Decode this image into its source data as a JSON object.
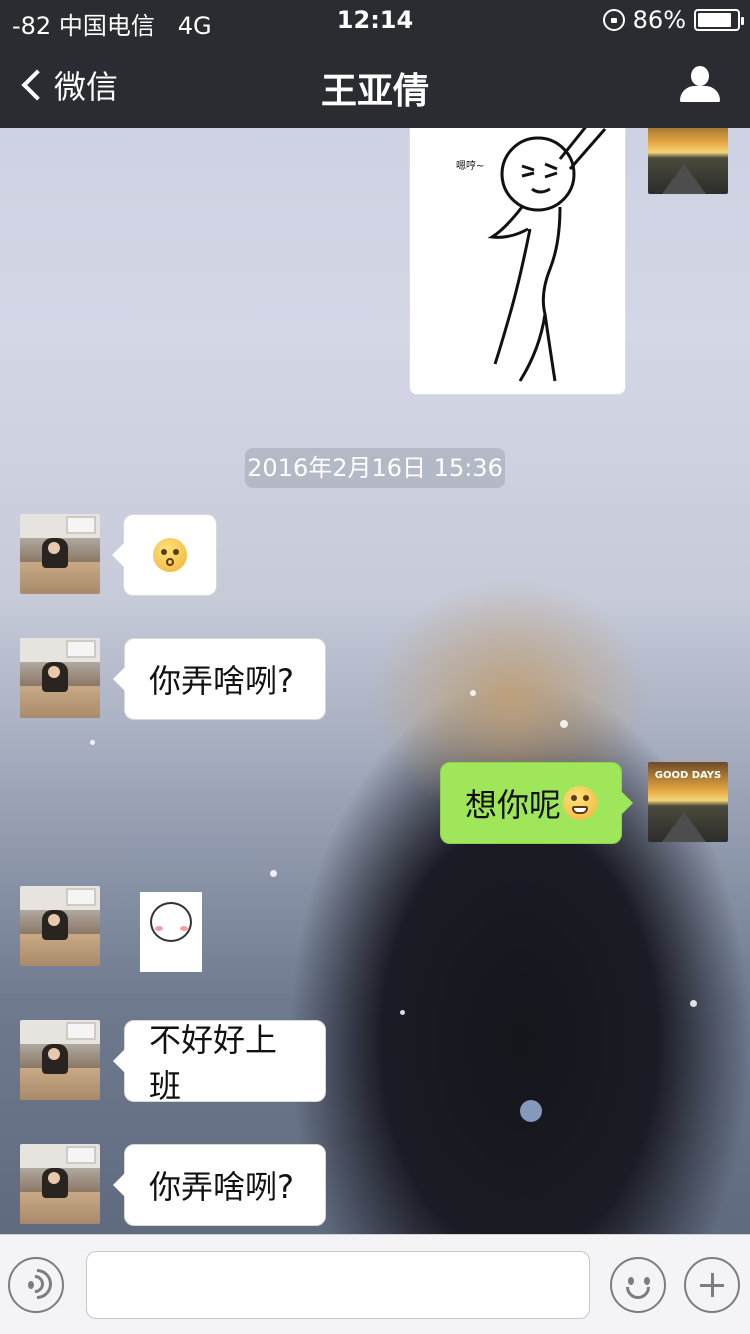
{
  "status_bar": {
    "carrier": "-82 中国电信",
    "network": "4G",
    "time": "12:14",
    "battery": "86%",
    "battery_level": 0.86
  },
  "nav": {
    "back_label": "微信",
    "title": "王亚倩"
  },
  "chat": {
    "sticker_caption": "嗯哼~",
    "timestamp": "2016年2月16日 15:36",
    "messages": [
      {
        "from": "other",
        "type": "emoji",
        "emoji": "shocked-face-emoji"
      },
      {
        "from": "other",
        "type": "text",
        "text": "你弄啥咧?"
      },
      {
        "from": "me",
        "type": "text",
        "text": "想你呢",
        "emoji": "grin-face-emoji"
      },
      {
        "from": "other",
        "type": "sticker",
        "emoji": "blushing-face-sticker"
      },
      {
        "from": "other",
        "type": "text",
        "text": "不好好上班"
      },
      {
        "from": "other",
        "type": "text",
        "text": "你弄啥咧?"
      }
    ],
    "my_avatar_text": "GOOD DAYS"
  },
  "input_bar": {
    "placeholder": "",
    "icons": [
      "voice-icon",
      "emoji-icon",
      "plus-icon"
    ]
  },
  "colors": {
    "nav_bg": "#2b2c31",
    "my_bubble": "#9fe65b",
    "other_bubble": "#ffffff"
  }
}
